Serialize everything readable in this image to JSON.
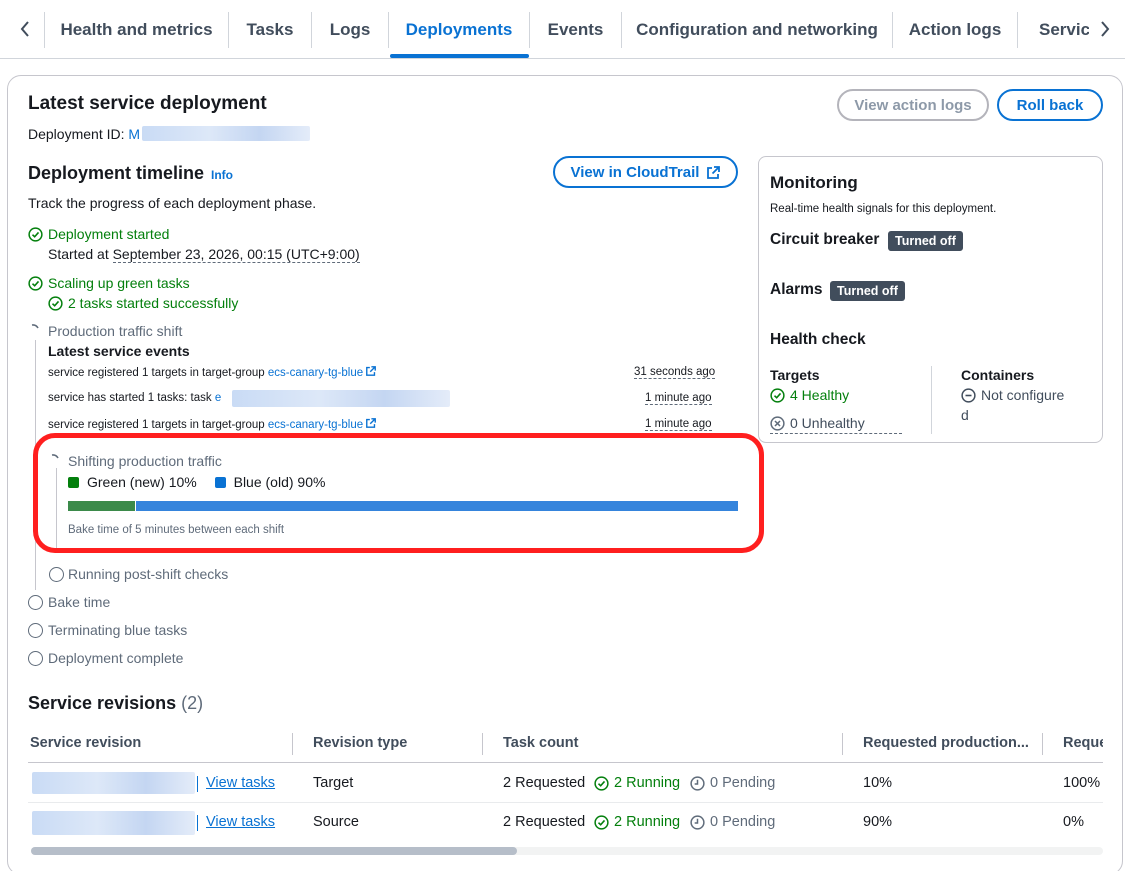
{
  "tabs": [
    {
      "label": "Health and metrics"
    },
    {
      "label": "Tasks"
    },
    {
      "label": "Logs"
    },
    {
      "label": "Deployments"
    },
    {
      "label": "Events"
    },
    {
      "label": "Configuration and networking"
    },
    {
      "label": "Action logs"
    },
    {
      "label": "Servic"
    }
  ],
  "active_tab": "Deployments",
  "deployment": {
    "title": "Latest service deployment",
    "id_label": "Deployment ID:",
    "id_visible_prefix": "M",
    "view_action_logs": "View action logs",
    "roll_back": "Roll back"
  },
  "timeline": {
    "title": "Deployment timeline",
    "info": "Info",
    "description": "Track the progress of each deployment phase.",
    "view_cloudtrail": "View in CloudTrail",
    "started": {
      "label": "Deployment started",
      "started_at_prefix": "Started at",
      "started_at": "September 23, 2026, 00:15 (UTC+9:00)"
    },
    "scaling": {
      "label": "Scaling up green tasks",
      "result": "2 tasks started successfully"
    },
    "production_shift": {
      "label": "Production traffic shift"
    },
    "events_title": "Latest service events",
    "events": [
      {
        "text": "service registered 1 targets in target-group",
        "link": "ecs-canary-tg-blue",
        "time": "31 seconds ago"
      },
      {
        "text": "service has started 1 tasks: task",
        "link_prefix": "e",
        "time": "1 minute ago"
      },
      {
        "text": "service registered 1 targets in target-group",
        "link": "ecs-canary-tg-blue",
        "time": "1 minute ago"
      }
    ],
    "shifting": {
      "label": "Shifting production traffic",
      "green_label": "Green (new) 10%",
      "blue_label": "Blue (old) 90%",
      "green_percent": 10,
      "blue_percent": 90,
      "bake_note": "Bake time of 5 minutes between each shift",
      "green_color": "#3b8a4a",
      "blue_color": "#3584dc"
    },
    "post_checks": "Running post-shift checks",
    "bake_time": "Bake time",
    "terminating": "Terminating blue tasks",
    "complete": "Deployment complete"
  },
  "monitoring": {
    "title": "Monitoring",
    "subtitle": "Real-time health signals for this deployment.",
    "circuit_breaker": {
      "label": "Circuit breaker",
      "status": "Turned off"
    },
    "alarms": {
      "label": "Alarms",
      "status": "Turned off"
    },
    "health_check": "Health check",
    "targets": {
      "label": "Targets",
      "healthy": "4 Healthy",
      "unhealthy": "0 Unhealthy"
    },
    "containers": {
      "label": "Containers",
      "status_line1": "Not configure",
      "status_line2": "d"
    }
  },
  "revisions": {
    "title": "Service revisions",
    "count": "(2)",
    "columns": [
      "Service revision",
      "Revision type",
      "Task count",
      "Requested production...",
      "Reque"
    ],
    "rows": [
      {
        "view": "View tasks",
        "type": "Target",
        "requested": "2 Requested",
        "running": "2 Running",
        "pending": "0 Pending",
        "prod": "10%",
        "req2": "100%"
      },
      {
        "view": "View tasks",
        "type": "Source",
        "requested": "2 Requested",
        "running": "2 Running",
        "pending": "0 Pending",
        "prod": "90%",
        "req2": "0%"
      }
    ]
  },
  "colors": {
    "accent": "#0972d3",
    "success": "#037f0c",
    "highlight": "#ff1f1f"
  }
}
